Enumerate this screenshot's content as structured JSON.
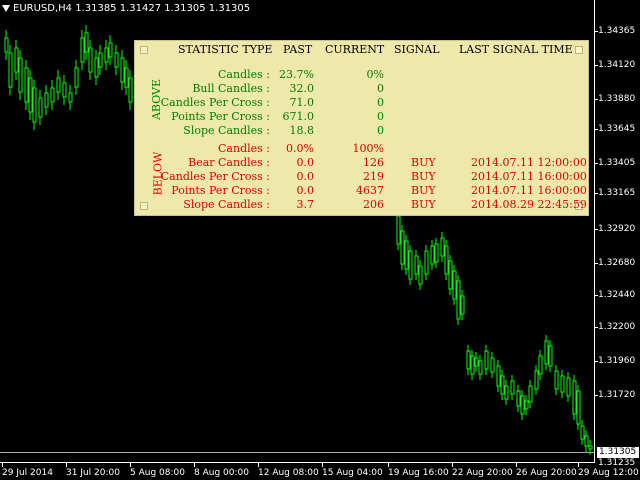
{
  "header": {
    "symbol": "EURUSD,H4  1.31385 1.31427 1.31305 1.31305"
  },
  "colors": {
    "background": "#000000",
    "bull_candle": "#00ff00",
    "panel_bg": "#eee8aa",
    "above": "#008000",
    "below": "#e00000"
  },
  "price_axis": {
    "labels": [
      "1.34365",
      "1.34120",
      "1.33880",
      "1.33645",
      "1.33405",
      "1.33165",
      "1.32920",
      "1.32680",
      "1.32440",
      "1.32200",
      "1.31960",
      "1.31720"
    ],
    "current_price": "1.31305",
    "bottom_label": "1.31235"
  },
  "time_axis": {
    "labels": [
      "29 Jul 2014",
      "31 Jul 20:00",
      "5 Aug 08:00",
      "8 Aug 00:00",
      "12 Aug 08:00",
      "15 Aug 04:00",
      "19 Aug 16:00",
      "22 Aug 20:00",
      "26 Aug 20:00",
      "29 Aug 12:00"
    ]
  },
  "panel": {
    "headers": {
      "type": "STATISTIC TYPE",
      "past": "PAST",
      "current": "CURRENT",
      "signal": "SIGNAL",
      "last": "LAST SIGNAL TIME"
    },
    "above_label": "ABOVE",
    "below_label": "BELOW",
    "above_rows": [
      {
        "label": "Candles :",
        "past": "23.7%",
        "current": "0%"
      },
      {
        "label": "Bull Candles :",
        "past": "32.0",
        "current": "0"
      },
      {
        "label": "Candles Per Cross :",
        "past": "71.0",
        "current": "0"
      },
      {
        "label": "Points Per Cross :",
        "past": "671.0",
        "current": "0"
      },
      {
        "label": "Slope Candles :",
        "past": "18.8",
        "current": "0"
      }
    ],
    "below_rows": [
      {
        "label": "Candles :",
        "past": "0.0%",
        "current": "100%",
        "signal": "",
        "time": ""
      },
      {
        "label": "Bear Candles :",
        "past": "0.0",
        "current": "126",
        "signal": "BUY",
        "time": "2014.07.11 12:00:00"
      },
      {
        "label": "Candles Per Cross :",
        "past": "0.0",
        "current": "219",
        "signal": "BUY",
        "time": "2014.07.11 16:00:00"
      },
      {
        "label": "Points Per Cross :",
        "past": "0.0",
        "current": "4637",
        "signal": "BUY",
        "time": "2014.07.11 16:00:00"
      },
      {
        "label": "Slope Candles :",
        "past": "3.7",
        "current": "206",
        "signal": "BUY",
        "time": "2014.08.29 22:45:59"
      }
    ]
  }
}
